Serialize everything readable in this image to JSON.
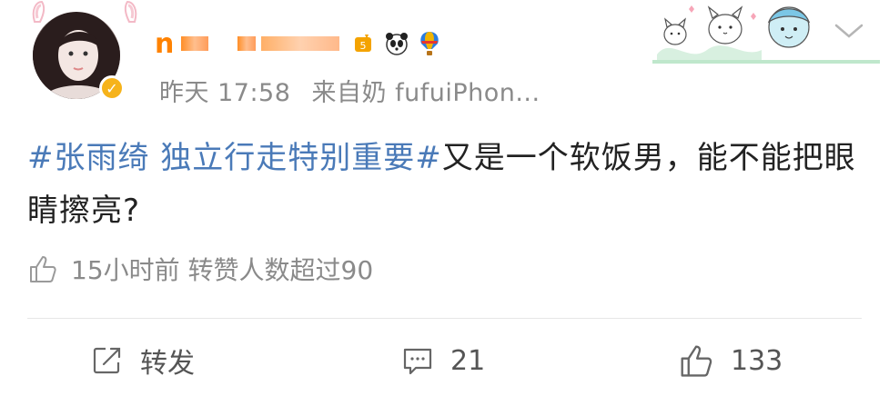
{
  "user": {
    "name_visible": "n",
    "source_label": "昨天 17:58",
    "via_label": "来自奶 fufuiPhon..."
  },
  "post": {
    "hashtag": "#张雨绮 独立行走特别重要#",
    "text": "又是一个软饭男，能不能把眼睛擦亮?"
  },
  "likes_summary": "15小时前 转赞人数超过90",
  "actions": {
    "repost_label": "转发",
    "comment_count": "21",
    "like_count": "133"
  },
  "colors": {
    "accent": "#ff8200",
    "hashtag": "#4a7ab8",
    "meta": "#8a8a8a"
  }
}
